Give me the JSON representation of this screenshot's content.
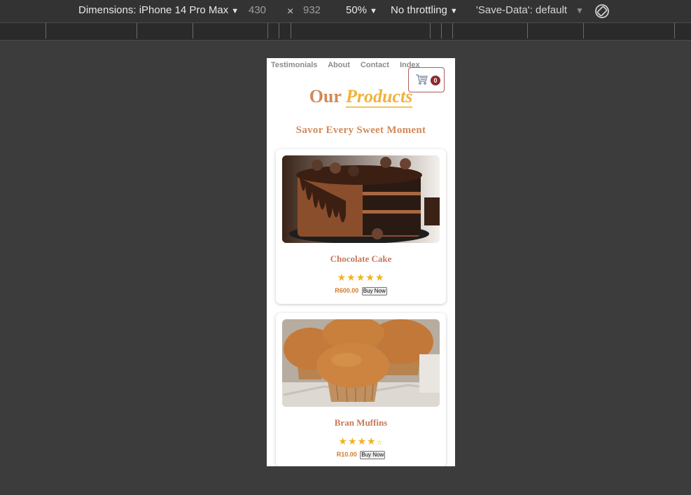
{
  "toolbar": {
    "dimensions_label": "Dimensions: iPhone 14 Pro Max",
    "width": "430",
    "times": "×",
    "height": "932",
    "zoom": "50%",
    "throttling": "No throttling",
    "save_data": "'Save-Data': default",
    "rotate_icon": "rotate-icon"
  },
  "page": {
    "nav": [
      "Testimonials",
      "About",
      "Contact",
      "Index"
    ],
    "cart_count": "0",
    "cart_icon": "cart-icon",
    "title_part1": "Our",
    "title_part2": "Products",
    "subtitle": "Savor Every Sweet Moment",
    "products": [
      {
        "name": "Chocolate Cake",
        "price": "R600.00",
        "buy_label": "Buy Now",
        "stars": "★★★★★",
        "rating": 5
      },
      {
        "name": "Bran Muffins",
        "price": "R10.00",
        "buy_label": "Buy Now",
        "stars": "★★★★",
        "empty_stars": "☆",
        "rating": 4
      }
    ]
  },
  "colors": {
    "accent_title": "#d08a5a",
    "accent_products": "#f0b23a",
    "star": "#f2b21a",
    "price": "#d27a2c",
    "badge": "#8e2a2a"
  }
}
